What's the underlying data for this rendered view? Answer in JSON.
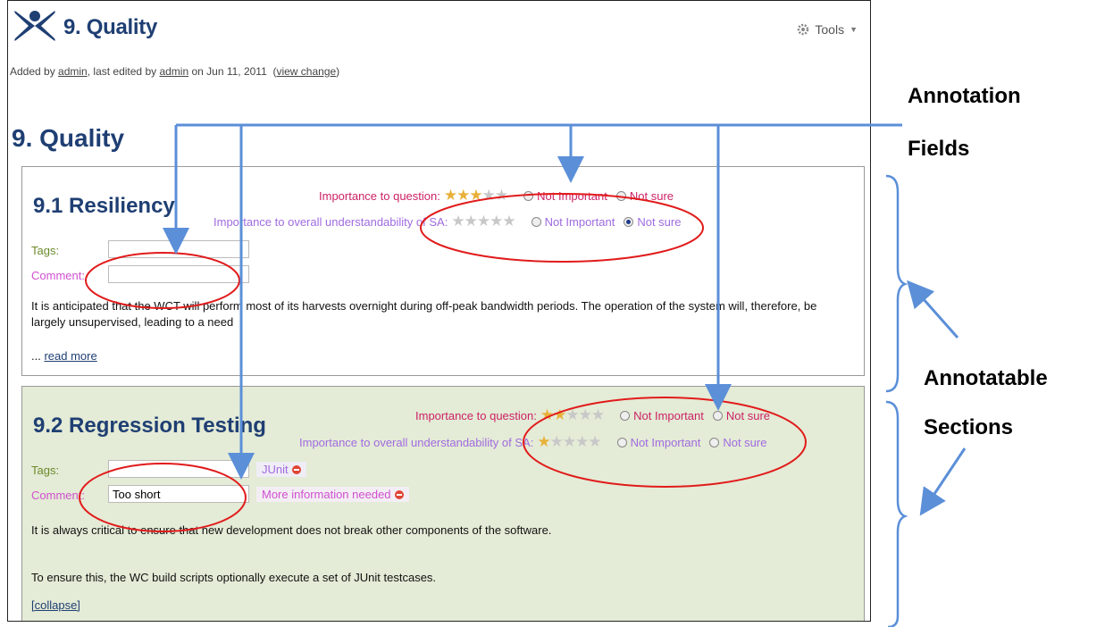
{
  "header": {
    "title": "9. Quality",
    "tools_label": "Tools"
  },
  "meta": {
    "added_by": "Added by ",
    "author": "admin",
    "edited_by": ", last edited by ",
    "editor": "admin",
    "date": " on Jun 11, 2011",
    "view_change": "view change"
  },
  "page_title": "9. Quality",
  "rating_labels": {
    "importance_question": "Importance to question:",
    "importance_overall": "Importance to overall understandability of SA:",
    "not_important": "Not Important",
    "not_sure": "Not sure"
  },
  "field_labels": {
    "tags": "Tags:",
    "comment": "Comment:"
  },
  "sections": [
    {
      "title": "9.1 Resiliency",
      "question_stars": 3,
      "overall_stars": 0,
      "overall_selected": "not_sure",
      "tags_value": "",
      "comment_value": "",
      "text1": "It is anticipated that the WCT will perform most of its harvests overnight during off-peak bandwidth periods. The operation of the system will, therefore, be",
      "text2": "largely unsupervised, leading to a need",
      "link_prefix": "... ",
      "link": "read more"
    },
    {
      "title": "9.2 Regression Testing",
      "question_stars": 2,
      "overall_stars": 1,
      "tags_value": "",
      "comment_value": "Too short",
      "tag_annotation": "JUnit",
      "comment_annotation": "More information needed",
      "text1": "It is always critical to ensure that new development does not break other components of the software.",
      "text2": "To ensure this, the WC build scripts optionally execute a set of JUnit testcases.",
      "link": "[collapse]"
    }
  ],
  "annotations": {
    "fields_line1": "Annotation",
    "fields_line2": "Fields",
    "sections_line1": "Annotatable",
    "sections_line2": "Sections"
  },
  "colors": {
    "title": "#1f3f73",
    "ellipse": "#e11b1b",
    "arrow": "#5b8fd8",
    "section2_bg": "#e4ebd6"
  }
}
